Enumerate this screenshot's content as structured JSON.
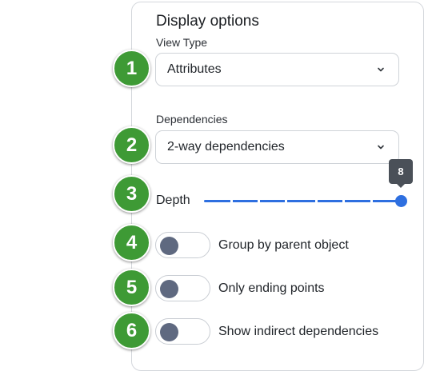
{
  "panel": {
    "title": "Display options"
  },
  "view_type": {
    "label": "View Type",
    "value": "Attributes"
  },
  "dependencies": {
    "label": "Dependencies",
    "value": "2-way dependencies"
  },
  "depth": {
    "label": "Depth",
    "value": "8",
    "max": 8
  },
  "toggles": [
    {
      "label": "Group by parent object",
      "on": false
    },
    {
      "label": "Only ending points",
      "on": false
    },
    {
      "label": "Show indirect dependencies",
      "on": false
    }
  ],
  "badges": [
    "1",
    "2",
    "3",
    "4",
    "5",
    "6"
  ],
  "colors": {
    "badge_green": "#3e9a35",
    "slider_blue": "#2e6fe0",
    "tooltip_gray": "#4a5058",
    "knob_gray": "#5f6980"
  },
  "icons": {
    "dropdown": "chevron-down-icon"
  }
}
